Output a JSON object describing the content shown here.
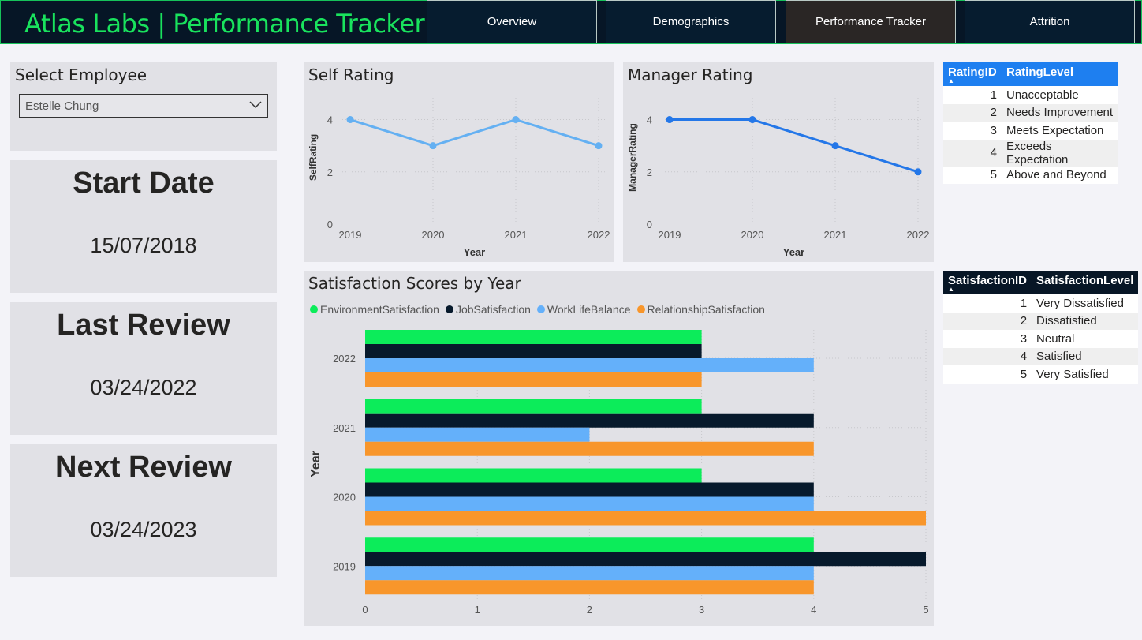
{
  "header": {
    "title": "Atlas Labs | Performance Tracker",
    "nav": [
      "Overview",
      "Demographics",
      "Performance Tracker",
      "Attrition"
    ],
    "active_nav": "Performance Tracker"
  },
  "colors": {
    "header_bg": "#061626",
    "title_green": "#19e35d",
    "panel_bg": "#e1e1e6",
    "self_rating_line": "#64b0f2",
    "manager_rating_line": "#2477e8",
    "environment": "#0cec5a",
    "job": "#071a2c",
    "worklife": "#64b0fa",
    "relationship": "#f8962b",
    "rating_table_header": "#1e7ff0",
    "satisfaction_table_header": "#071626"
  },
  "employee_select": {
    "title": "Select Employee",
    "value": "Estelle Chung",
    "icon": "chevron-down-icon"
  },
  "cards": {
    "start_date": {
      "label": "Start Date",
      "value": "15/07/2018"
    },
    "last_review": {
      "label": "Last Review",
      "value": "03/24/2022"
    },
    "next_review": {
      "label": "Next Review",
      "value": "03/24/2023"
    }
  },
  "chart_data": [
    {
      "type": "line",
      "title": "Self Rating",
      "xlabel": "Year",
      "ylabel": "SelfRating",
      "x": [
        "2019",
        "2020",
        "2021",
        "2022"
      ],
      "y": [
        4,
        3,
        4,
        3
      ],
      "yticks": [
        "0",
        "2",
        "4"
      ],
      "ylim": [
        0,
        4.5
      ]
    },
    {
      "type": "line",
      "title": "Manager Rating",
      "xlabel": "Year",
      "ylabel": "ManagerRating",
      "x": [
        "2019",
        "2020",
        "2021",
        "2022"
      ],
      "y": [
        4,
        4,
        3,
        2
      ],
      "yticks": [
        "0",
        "2",
        "4"
      ],
      "ylim": [
        0,
        4.5
      ]
    },
    {
      "type": "bar",
      "orientation": "horizontal",
      "title": "Satisfaction Scores by Year",
      "ylabel": "Year",
      "categories": [
        "2022",
        "2021",
        "2020",
        "2019"
      ],
      "xticks": [
        "0",
        "1",
        "2",
        "3",
        "4",
        "5"
      ],
      "xlim": [
        0,
        5
      ],
      "series": [
        {
          "name": "EnvironmentSatisfaction",
          "values": [
            3,
            3,
            3,
            4
          ]
        },
        {
          "name": "JobSatisfaction",
          "values": [
            3,
            4,
            4,
            5
          ]
        },
        {
          "name": "WorkLifeBalance",
          "values": [
            4,
            2,
            4,
            4
          ]
        },
        {
          "name": "RelationshipSatisfaction",
          "values": [
            3,
            4,
            5,
            4
          ]
        }
      ]
    }
  ],
  "rating_table": {
    "headers": [
      "RatingID",
      "RatingLevel"
    ],
    "rows": [
      [
        "1",
        "Unacceptable"
      ],
      [
        "2",
        "Needs Improvement"
      ],
      [
        "3",
        "Meets Expectation"
      ],
      [
        "4",
        "Exceeds Expectation"
      ],
      [
        "5",
        "Above and Beyond"
      ]
    ]
  },
  "satisfaction_table": {
    "headers": [
      "SatisfactionID",
      "SatisfactionLevel"
    ],
    "rows": [
      [
        "1",
        "Very Dissatisfied"
      ],
      [
        "2",
        "Dissatisfied"
      ],
      [
        "3",
        "Neutral"
      ],
      [
        "4",
        "Satisfied"
      ],
      [
        "5",
        "Very Satisfied"
      ]
    ]
  }
}
